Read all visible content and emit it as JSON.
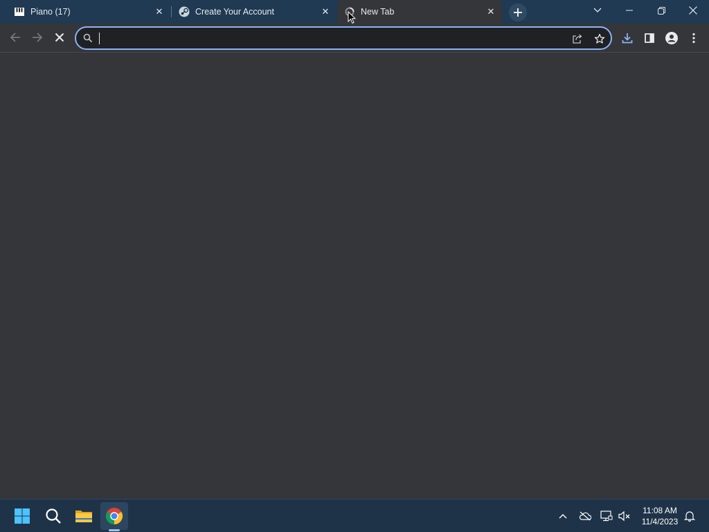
{
  "tabs": [
    {
      "title": "Piano (17)",
      "favicon": "piano-icon",
      "active": false
    },
    {
      "title": "Create Your Account",
      "favicon": "steam-icon",
      "active": false
    },
    {
      "title": "New Tab",
      "favicon": "loading-icon",
      "active": true
    }
  ],
  "omnibox": {
    "value": "",
    "placeholder": ""
  },
  "taskbar": {
    "apps": [
      "start-icon",
      "search-icon",
      "file-explorer-icon",
      "chrome-icon"
    ],
    "clock": {
      "time": "11:08 AM",
      "date": "11/4/2023"
    }
  },
  "colors": {
    "tabstrip": "#1f3a52",
    "toolbar": "#35363a",
    "omnibox_border": "#8ab4f8",
    "taskbar": "#1e3348",
    "accent_download": "#8ab4f8"
  }
}
